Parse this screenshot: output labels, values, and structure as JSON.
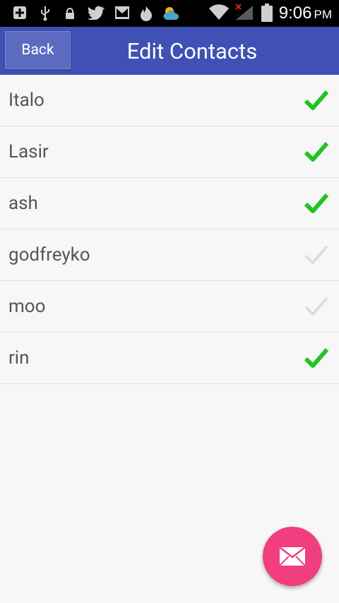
{
  "status_bar": {
    "time": "9:06",
    "ampm": "PM",
    "icons": [
      "plus-square-icon",
      "usb-icon",
      "lock-icon",
      "twitter-icon",
      "mail-icon",
      "flame-icon",
      "weather-icon",
      "wifi-icon",
      "signal-icon",
      "battery-icon"
    ]
  },
  "header": {
    "back_label": "Back",
    "title": "Edit Contacts"
  },
  "contacts": [
    {
      "name": "Italo",
      "checked": true
    },
    {
      "name": "Lasir",
      "checked": true
    },
    {
      "name": "ash",
      "checked": true
    },
    {
      "name": "godfreyko",
      "checked": false
    },
    {
      "name": "moo",
      "checked": false
    },
    {
      "name": "rin",
      "checked": true
    }
  ],
  "colors": {
    "appbar": "#3f51b5",
    "check_on": "#22c322",
    "check_off": "#dddddd",
    "fab": "#f03e7f"
  },
  "fab": {
    "icon": "envelope-icon"
  }
}
